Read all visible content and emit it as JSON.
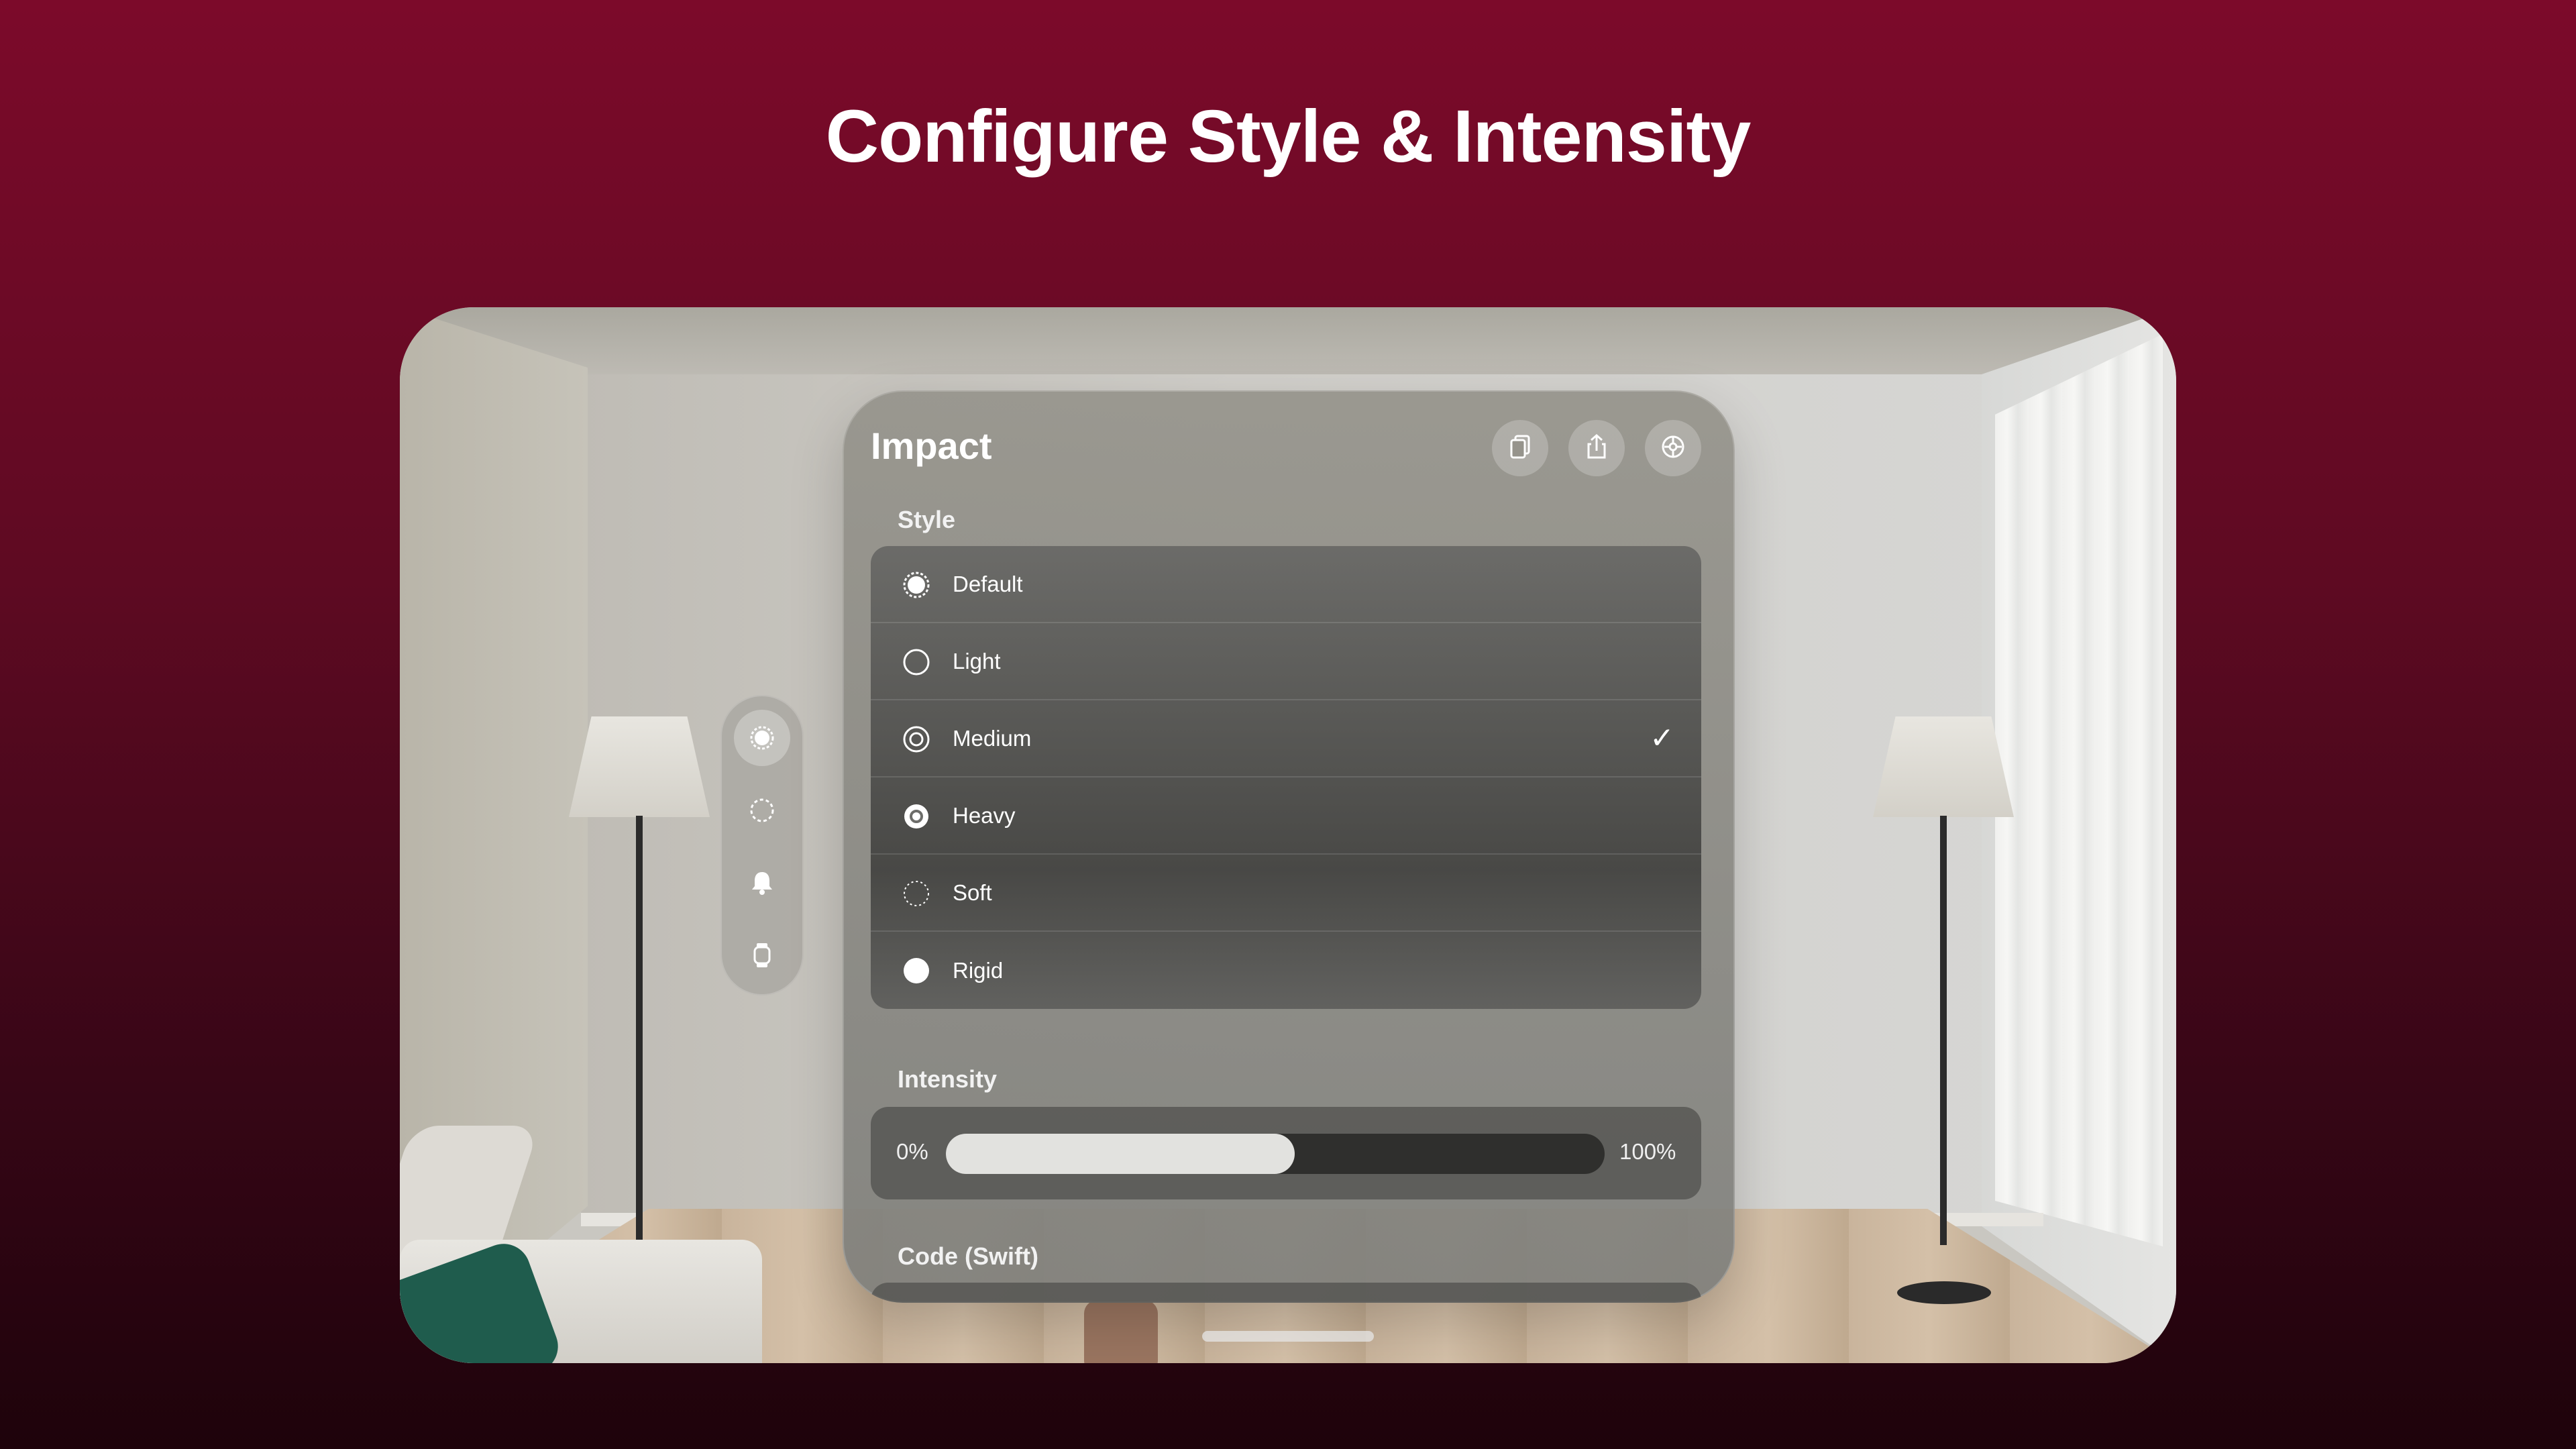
{
  "headline": "Configure Style & Intensity",
  "panel": {
    "title": "Impact",
    "toolbar": [
      {
        "icon": "copy-icon",
        "action": "copy"
      },
      {
        "icon": "share-icon",
        "action": "share"
      },
      {
        "icon": "settings-icon",
        "action": "settings"
      }
    ]
  },
  "style_section": {
    "label": "Style",
    "options": [
      {
        "label": "Default",
        "icon": "default-style-icon",
        "selected": false
      },
      {
        "label": "Light",
        "icon": "light-style-icon",
        "selected": false
      },
      {
        "label": "Medium",
        "icon": "medium-style-icon",
        "selected": true
      },
      {
        "label": "Heavy",
        "icon": "heavy-style-icon",
        "selected": false
      },
      {
        "label": "Soft",
        "icon": "soft-style-icon",
        "selected": false
      },
      {
        "label": "Rigid",
        "icon": "rigid-style-icon",
        "selected": false
      }
    ],
    "check_mark": "✓"
  },
  "intensity_section": {
    "label": "Intensity",
    "min_label": "0%",
    "max_label": "100%",
    "value": 0.53
  },
  "code_section": {
    "label": "Code (Swift)"
  },
  "side_toolbar": [
    {
      "icon": "impact-icon",
      "active": true
    },
    {
      "icon": "selection-icon",
      "active": false
    },
    {
      "icon": "bell-icon",
      "active": false
    },
    {
      "icon": "watch-icon",
      "active": false
    }
  ],
  "colors": {
    "background_top": "#7c0a2a",
    "background_bottom": "#1e030b",
    "text": "#ffffff"
  }
}
